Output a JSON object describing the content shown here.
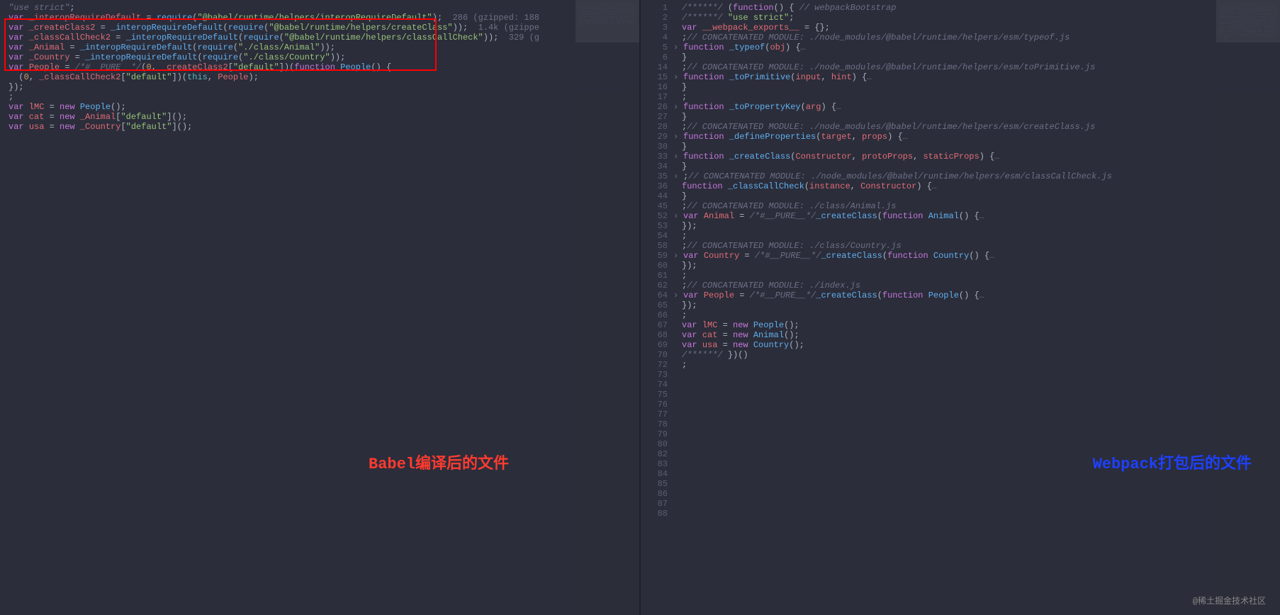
{
  "watermark": "@稀土掘金技术社区",
  "annotation_left": "Babel编译后的文件",
  "annotation_right": "Webpack打包后的文件",
  "left_pane": {
    "gutter": [
      " ",
      " ",
      " ",
      " ",
      " ",
      " ",
      " ",
      " ",
      " ",
      " ",
      " ",
      " ",
      " ",
      " ",
      " "
    ],
    "lines": [
      [
        [
          " c",
          "\"use strict\""
        ],
        [
          "p",
          ";"
        ]
      ],
      [],
      [
        [
          "k",
          "var "
        ],
        [
          "n",
          "_interopRequireDefault"
        ],
        [
          "p",
          " = "
        ],
        [
          "f",
          "require"
        ],
        [
          "p",
          "("
        ],
        [
          "s",
          "\"@babel/runtime/helpers/interopRequireDefault\""
        ],
        [
          "p",
          ");  "
        ],
        [
          "size-hint",
          "286 (gzipped: 188"
        ]
      ],
      [
        [
          "k",
          "var "
        ],
        [
          "n",
          "_createClass2"
        ],
        [
          "p",
          " = "
        ],
        [
          "f",
          "_interopRequireDefault"
        ],
        [
          "p",
          "("
        ],
        [
          "f",
          "require"
        ],
        [
          "p",
          "("
        ],
        [
          "s",
          "\"@babel/runtime/helpers/createClass\""
        ],
        [
          "p",
          "));  "
        ],
        [
          "size-hint",
          "1.4k (gzippe"
        ]
      ],
      [
        [
          "k",
          "var "
        ],
        [
          "n",
          "_classCallCheck2"
        ],
        [
          "p",
          " = "
        ],
        [
          "f",
          "_interopRequireDefault"
        ],
        [
          "p",
          "("
        ],
        [
          "f",
          "require"
        ],
        [
          "p",
          "("
        ],
        [
          "s",
          "\"@babel/runtime/helpers/classCallCheck\""
        ],
        [
          "p",
          "));  "
        ],
        [
          "size-hint",
          "329 (g"
        ]
      ],
      [
        [
          "k",
          "var "
        ],
        [
          "n",
          "_Animal"
        ],
        [
          "p",
          " = "
        ],
        [
          "f",
          "_interopRequireDefault"
        ],
        [
          "p",
          "("
        ],
        [
          "f",
          "require"
        ],
        [
          "p",
          "("
        ],
        [
          "s",
          "\"./class/Animal\""
        ],
        [
          "p",
          "));"
        ]
      ],
      [
        [
          "k",
          "var "
        ],
        [
          "n",
          "_Country"
        ],
        [
          "p",
          " = "
        ],
        [
          "f",
          "_interopRequireDefault"
        ],
        [
          "p",
          "("
        ],
        [
          "f",
          "require"
        ],
        [
          "p",
          "("
        ],
        [
          "s",
          "\"./class/Country\""
        ],
        [
          "p",
          "));"
        ]
      ],
      [
        [
          "k",
          "var "
        ],
        [
          "n",
          "People"
        ],
        [
          "p",
          " = "
        ],
        [
          "c",
          "/*#__PURE__*/"
        ],
        [
          "p",
          "("
        ],
        [
          "nu",
          "0"
        ],
        [
          "p",
          ", "
        ],
        [
          "n",
          "_createClass2"
        ],
        [
          "p",
          "["
        ],
        [
          "s",
          "\"default\""
        ],
        [
          "p",
          "])("
        ],
        [
          "k",
          "function "
        ],
        [
          "f",
          "People"
        ],
        [
          "p",
          "() {"
        ]
      ],
      [
        [
          "p",
          "  ("
        ],
        [
          "nu",
          "0"
        ],
        [
          "p",
          ", "
        ],
        [
          "n",
          "_classCallCheck2"
        ],
        [
          "p",
          "["
        ],
        [
          "s",
          "\"default\""
        ],
        [
          "p",
          "])("
        ],
        [
          "t",
          "this"
        ],
        [
          "p",
          ", "
        ],
        [
          "n",
          "People"
        ],
        [
          "p",
          ");"
        ]
      ],
      [
        [
          "p",
          "});"
        ]
      ],
      [
        [
          "p",
          ";"
        ]
      ],
      [
        [
          "k",
          "var "
        ],
        [
          "n",
          "lMC"
        ],
        [
          "p",
          " = "
        ],
        [
          "k",
          "new "
        ],
        [
          "f",
          "People"
        ],
        [
          "p",
          "();"
        ]
      ],
      [
        [
          "k",
          "var "
        ],
        [
          "n",
          "cat"
        ],
        [
          "p",
          " = "
        ],
        [
          "k",
          "new "
        ],
        [
          "n",
          "_Animal"
        ],
        [
          "p",
          "["
        ],
        [
          "s",
          "\"default\""
        ],
        [
          "p",
          "]();"
        ]
      ],
      [
        [
          "k",
          "var "
        ],
        [
          "n",
          "usa"
        ],
        [
          "p",
          " = "
        ],
        [
          "k",
          "new "
        ],
        [
          "n",
          "_Country"
        ],
        [
          "p",
          "["
        ],
        [
          "s",
          "\"default\""
        ],
        [
          "p",
          "]();"
        ]
      ],
      []
    ]
  },
  "right_pane": {
    "gutter": [
      "1",
      "2",
      "3",
      "4",
      "5",
      "6",
      "14",
      "15",
      "16",
      "17",
      "26",
      "27",
      "28",
      "29",
      "30",
      "33",
      "34",
      "35",
      "36",
      "44",
      "45",
      "52",
      "53",
      "54",
      "58",
      "59",
      "60",
      "61",
      "62",
      "64",
      "65",
      "66",
      "67",
      "68",
      "69",
      "70",
      "72",
      "73",
      "74",
      "75",
      "76",
      "77",
      "78",
      "79",
      "80",
      "82",
      "83",
      "84",
      "85",
      "86",
      "87",
      "88"
    ],
    "fold": {
      "5": ">",
      "9": ">",
      "14": ">",
      "18": ">",
      "20": ">",
      "22": ">",
      "28": ">",
      "35": ">",
      "44": ">"
    },
    "lines": [
      [
        [
          "c",
          "/******/ "
        ],
        [
          "p",
          "("
        ],
        [
          "k",
          "function"
        ],
        [
          "p",
          "() { "
        ],
        [
          "c",
          "// webpackBootstrap"
        ]
      ],
      [
        [
          "c",
          "/******/ "
        ],
        [
          "s",
          "\"use strict\""
        ],
        [
          "p",
          ";"
        ]
      ],
      [
        [
          "k",
          "var "
        ],
        [
          "n",
          "__webpack_exports__"
        ],
        [
          "p",
          " = {};"
        ]
      ],
      [],
      [
        [
          "p",
          ";"
        ],
        [
          "c",
          "// CONCATENATED MODULE: ./node_modules/@babel/runtime/helpers/esm/typeof.js"
        ]
      ],
      [
        [
          "k",
          "function "
        ],
        [
          "f",
          "_typeof"
        ],
        [
          "p",
          "("
        ],
        [
          "n",
          "obj"
        ],
        [
          "p",
          ") {"
        ],
        [
          "c",
          "…"
        ]
      ],
      [
        [
          "p",
          "}"
        ]
      ],
      [
        [
          "p",
          ";"
        ],
        [
          "c",
          "// CONCATENATED MODULE: ./node_modules/@babel/runtime/helpers/esm/toPrimitive.js"
        ]
      ],
      [],
      [
        [
          "k",
          "function "
        ],
        [
          "f",
          "_toPrimitive"
        ],
        [
          "p",
          "("
        ],
        [
          "n",
          "input"
        ],
        [
          "p",
          ", "
        ],
        [
          "n",
          "hint"
        ],
        [
          "p",
          ") {"
        ],
        [
          "c",
          "…"
        ]
      ],
      [
        [
          "p",
          "}"
        ]
      ],
      [
        [
          "p",
          ";"
        ]
      ],
      [],
      [],
      [
        [
          "k",
          "function "
        ],
        [
          "f",
          "_toPropertyKey"
        ],
        [
          "p",
          "("
        ],
        [
          "n",
          "arg"
        ],
        [
          "p",
          ") {"
        ],
        [
          "c",
          "…"
        ]
      ],
      [
        [
          "p",
          "}"
        ]
      ],
      [
        [
          "p",
          ";"
        ],
        [
          "c",
          "// CONCATENATED MODULE: ./node_modules/@babel/runtime/helpers/esm/createClass.js"
        ]
      ],
      [],
      [
        [
          "k",
          "function "
        ],
        [
          "f",
          "_defineProperties"
        ],
        [
          "p",
          "("
        ],
        [
          "n",
          "target"
        ],
        [
          "p",
          ", "
        ],
        [
          "n",
          "props"
        ],
        [
          "p",
          ") {"
        ],
        [
          "c",
          "…"
        ]
      ],
      [
        [
          "p",
          "}"
        ]
      ],
      [
        [
          "k",
          "function "
        ],
        [
          "f",
          "_createClass"
        ],
        [
          "p",
          "("
        ],
        [
          "n",
          "Constructor"
        ],
        [
          "p",
          ", "
        ],
        [
          "n",
          "protoProps"
        ],
        [
          "p",
          ", "
        ],
        [
          "n",
          "staticProps"
        ],
        [
          "p",
          ") {"
        ],
        [
          "c",
          "…"
        ]
      ],
      [
        [
          "p",
          "}"
        ]
      ],
      [
        [
          "p",
          ";"
        ],
        [
          "c",
          "// CONCATENATED MODULE: ./node_modules/@babel/runtime/helpers/esm/classCallCheck.js"
        ]
      ],
      [
        [
          "k",
          "function "
        ],
        [
          "f",
          "_classCallCheck"
        ],
        [
          "p",
          "("
        ],
        [
          "n",
          "instance"
        ],
        [
          "p",
          ", "
        ],
        [
          "n",
          "Constructor"
        ],
        [
          "p",
          ") {"
        ],
        [
          "c",
          "…"
        ]
      ],
      [
        [
          "p",
          "}"
        ]
      ],
      [
        [
          "p",
          ";"
        ],
        [
          "c",
          "// CONCATENATED MODULE: ./class/Animal.js"
        ]
      ],
      [],
      [],
      [
        [
          "k",
          "var "
        ],
        [
          "n",
          "Animal"
        ],
        [
          "p",
          " = "
        ],
        [
          "c",
          "/*#__PURE__*/"
        ],
        [
          "f",
          "_createClass"
        ],
        [
          "p",
          "("
        ],
        [
          "k",
          "function "
        ],
        [
          "f",
          "Animal"
        ],
        [
          "p",
          "() {"
        ],
        [
          "c",
          "…"
        ]
      ],
      [
        [
          "p",
          "});"
        ]
      ],
      [],
      [
        [
          "p",
          ";"
        ]
      ],
      [
        [
          "p",
          ";"
        ],
        [
          "c",
          "// CONCATENATED MODULE: ./class/Country.js"
        ]
      ],
      [],
      [],
      [
        [
          "k",
          "var "
        ],
        [
          "n",
          "Country"
        ],
        [
          "p",
          " = "
        ],
        [
          "c",
          "/*#__PURE__*/"
        ],
        [
          "f",
          "_createClass"
        ],
        [
          "p",
          "("
        ],
        [
          "k",
          "function "
        ],
        [
          "f",
          "Country"
        ],
        [
          "p",
          "() {"
        ],
        [
          "c",
          "…"
        ]
      ],
      [
        [
          "p",
          "});"
        ]
      ],
      [],
      [
        [
          "p",
          ";"
        ]
      ],
      [
        [
          "p",
          ";"
        ],
        [
          "c",
          "// CONCATENATED MODULE: ./index.js"
        ]
      ],
      [],
      [],
      [],
      [],
      [
        [
          "k",
          "var "
        ],
        [
          "n",
          "People"
        ],
        [
          "p",
          " = "
        ],
        [
          "c",
          "/*#__PURE__*/"
        ],
        [
          "f",
          "_createClass"
        ],
        [
          "p",
          "("
        ],
        [
          "k",
          "function "
        ],
        [
          "f",
          "People"
        ],
        [
          "p",
          "() {"
        ],
        [
          "c",
          "…"
        ]
      ],
      [
        [
          "p",
          "});"
        ]
      ],
      [
        [
          "p",
          ";"
        ]
      ],
      [
        [
          "k",
          "var "
        ],
        [
          "n",
          "lMC"
        ],
        [
          "p",
          " = "
        ],
        [
          "k",
          "new "
        ],
        [
          "f",
          "People"
        ],
        [
          "p",
          "();"
        ]
      ],
      [
        [
          "k",
          "var "
        ],
        [
          "n",
          "cat"
        ],
        [
          "p",
          " = "
        ],
        [
          "k",
          "new "
        ],
        [
          "f",
          "Animal"
        ],
        [
          "p",
          "();"
        ]
      ],
      [
        [
          "k",
          "var "
        ],
        [
          "n",
          "usa"
        ],
        [
          "p",
          " = "
        ],
        [
          "k",
          "new "
        ],
        [
          "f",
          "Country"
        ],
        [
          "p",
          "();"
        ]
      ],
      [
        [
          "c",
          "/******/ "
        ],
        [
          "p",
          "})()"
        ]
      ],
      [
        [
          "p",
          ";"
        ]
      ]
    ]
  }
}
